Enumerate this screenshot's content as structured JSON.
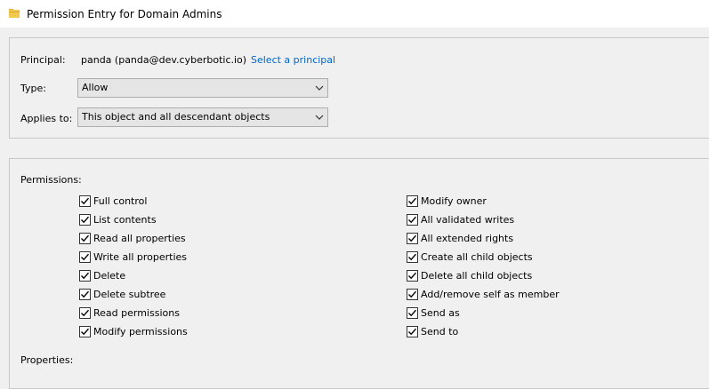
{
  "window": {
    "title": "Permission Entry for Domain Admins",
    "icon": "folder-icon"
  },
  "principal": {
    "label": "Principal:",
    "value": "panda (panda@dev.cyberbotic.io)",
    "link": "Select a principal"
  },
  "type": {
    "label": "Type:",
    "value": "Allow"
  },
  "applies_to": {
    "label": "Applies to:",
    "value": "This object and all descendant objects"
  },
  "permissions": {
    "heading": "Permissions:",
    "left": [
      {
        "label": "Full control",
        "checked": true
      },
      {
        "label": "List contents",
        "checked": true
      },
      {
        "label": "Read all properties",
        "checked": true
      },
      {
        "label": "Write all properties",
        "checked": true
      },
      {
        "label": "Delete",
        "checked": true
      },
      {
        "label": "Delete subtree",
        "checked": true
      },
      {
        "label": "Read permissions",
        "checked": true
      },
      {
        "label": "Modify permissions",
        "checked": true
      }
    ],
    "right": [
      {
        "label": "Modify owner",
        "checked": true
      },
      {
        "label": "All validated writes",
        "checked": true
      },
      {
        "label": "All extended rights",
        "checked": true
      },
      {
        "label": "Create all child objects",
        "checked": true
      },
      {
        "label": "Delete all child objects",
        "checked": true
      },
      {
        "label": "Add/remove self as member",
        "checked": true
      },
      {
        "label": "Send as",
        "checked": true
      },
      {
        "label": "Send to",
        "checked": true
      }
    ]
  },
  "properties": {
    "heading": "Properties:"
  },
  "colors": {
    "link": "#0066cc",
    "background": "#f0f0f0",
    "titlebar": "#ffffff"
  }
}
